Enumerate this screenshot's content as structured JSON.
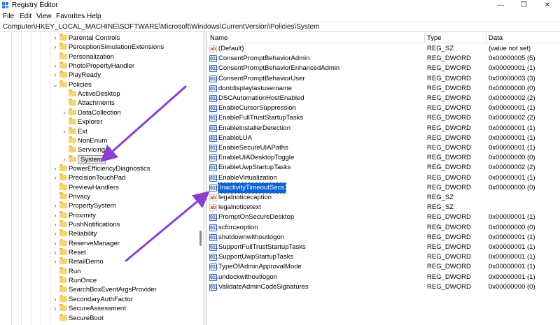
{
  "window": {
    "title": "Registry Editor",
    "minimize_glyph": "—",
    "maximize_glyph": "❐",
    "close_glyph": "✕"
  },
  "menu": [
    "File",
    "Edit",
    "View",
    "Favorites",
    "Help"
  ],
  "address": "Computer\\HKEY_LOCAL_MACHINE\\SOFTWARE\\Microsoft\\Windows\\CurrentVersion\\Policies\\System",
  "tree": [
    {
      "label": "Parental Controls",
      "level": 0,
      "expander": "collapsed"
    },
    {
      "label": "PerceptionSimulationExtensions",
      "level": 0,
      "expander": "collapsed"
    },
    {
      "label": "Personalization",
      "level": 0,
      "expander": "none"
    },
    {
      "label": "PhotoPropertyHandler",
      "level": 0,
      "expander": "collapsed"
    },
    {
      "label": "PlayReady",
      "level": 0,
      "expander": "collapsed"
    },
    {
      "label": "Policies",
      "level": 0,
      "expander": "expanded"
    },
    {
      "label": "ActiveDesktop",
      "level": 1,
      "expander": "none"
    },
    {
      "label": "Attachments",
      "level": 1,
      "expander": "none"
    },
    {
      "label": "DataCollection",
      "level": 1,
      "expander": "collapsed"
    },
    {
      "label": "Explorer",
      "level": 1,
      "expander": "none"
    },
    {
      "label": "Ext",
      "level": 1,
      "expander": "collapsed"
    },
    {
      "label": "NonEnum",
      "level": 1,
      "expander": "none"
    },
    {
      "label": "Servicing",
      "level": 1,
      "expander": "none"
    },
    {
      "label": "System",
      "level": 1,
      "expander": "collapsed",
      "selected": true
    },
    {
      "label": "PowerEfficiencyDiagnostics",
      "level": 0,
      "expander": "collapsed"
    },
    {
      "label": "PrecisionTouchPad",
      "level": 0,
      "expander": "collapsed"
    },
    {
      "label": "PreviewHandlers",
      "level": 0,
      "expander": "none"
    },
    {
      "label": "Privacy",
      "level": 0,
      "expander": "none"
    },
    {
      "label": "PropertySystem",
      "level": 0,
      "expander": "collapsed"
    },
    {
      "label": "Proximity",
      "level": 0,
      "expander": "collapsed"
    },
    {
      "label": "PushNotifications",
      "level": 0,
      "expander": "collapsed"
    },
    {
      "label": "Reliability",
      "level": 0,
      "expander": "collapsed"
    },
    {
      "label": "ReserveManager",
      "level": 0,
      "expander": "collapsed"
    },
    {
      "label": "Reset",
      "level": 0,
      "expander": "collapsed"
    },
    {
      "label": "RetailDemo",
      "level": 0,
      "expander": "collapsed"
    },
    {
      "label": "Run",
      "level": 0,
      "expander": "none"
    },
    {
      "label": "RunOnce",
      "level": 0,
      "expander": "none"
    },
    {
      "label": "SearchBoxEventArgsProvider",
      "level": 0,
      "expander": "none"
    },
    {
      "label": "SecondaryAuthFactor",
      "level": 0,
      "expander": "collapsed"
    },
    {
      "label": "SecureAssessment",
      "level": 0,
      "expander": "collapsed"
    },
    {
      "label": "SecureBoot",
      "level": 0,
      "expander": "none"
    }
  ],
  "list_columns": {
    "name": "Name",
    "type": "Type",
    "data": "Data"
  },
  "values": [
    {
      "name": "(Default)",
      "type": "REG_SZ",
      "data": "(value not set)",
      "icon": "sz"
    },
    {
      "name": "ConsentPromptBehaviorAdmin",
      "type": "REG_DWORD",
      "data": "0x00000005 (5)",
      "icon": "dword"
    },
    {
      "name": "ConsentPromptBehaviorEnhancedAdmin",
      "type": "REG_DWORD",
      "data": "0x00000001 (1)",
      "icon": "dword"
    },
    {
      "name": "ConsentPromptBehaviorUser",
      "type": "REG_DWORD",
      "data": "0x00000003 (3)",
      "icon": "dword"
    },
    {
      "name": "dontdisplaylastusername",
      "type": "REG_DWORD",
      "data": "0x00000000 (0)",
      "icon": "dword"
    },
    {
      "name": "DSCAutomationHostEnabled",
      "type": "REG_DWORD",
      "data": "0x00000002 (2)",
      "icon": "dword"
    },
    {
      "name": "EnableCursorSuppression",
      "type": "REG_DWORD",
      "data": "0x00000001 (1)",
      "icon": "dword"
    },
    {
      "name": "EnableFullTrustStartupTasks",
      "type": "REG_DWORD",
      "data": "0x00000002 (2)",
      "icon": "dword"
    },
    {
      "name": "EnableInstallerDetection",
      "type": "REG_DWORD",
      "data": "0x00000001 (1)",
      "icon": "dword"
    },
    {
      "name": "EnableLUA",
      "type": "REG_DWORD",
      "data": "0x00000001 (1)",
      "icon": "dword"
    },
    {
      "name": "EnableSecureUIAPaths",
      "type": "REG_DWORD",
      "data": "0x00000001 (1)",
      "icon": "dword"
    },
    {
      "name": "EnableUIADesktopToggle",
      "type": "REG_DWORD",
      "data": "0x00000000 (0)",
      "icon": "dword"
    },
    {
      "name": "EnableUwpStartupTasks",
      "type": "REG_DWORD",
      "data": "0x00000002 (2)",
      "icon": "dword"
    },
    {
      "name": "EnableVirtualization",
      "type": "REG_DWORD",
      "data": "0x00000001 (1)",
      "icon": "dword"
    },
    {
      "name": "InactivityTimeoutSecs",
      "type": "REG_DWORD",
      "data": "0x00000000 (0)",
      "icon": "dword",
      "selected": true
    },
    {
      "name": "legalnoticecaption",
      "type": "REG_SZ",
      "data": "",
      "icon": "sz"
    },
    {
      "name": "legalnoticetext",
      "type": "REG_SZ",
      "data": "",
      "icon": "sz"
    },
    {
      "name": "PromptOnSecureDesktop",
      "type": "REG_DWORD",
      "data": "0x00000001 (1)",
      "icon": "dword"
    },
    {
      "name": "scforceoption",
      "type": "REG_DWORD",
      "data": "0x00000000 (0)",
      "icon": "dword"
    },
    {
      "name": "shutdownwithoutlogon",
      "type": "REG_DWORD",
      "data": "0x00000001 (1)",
      "icon": "dword"
    },
    {
      "name": "SupportFullTrustStartupTasks",
      "type": "REG_DWORD",
      "data": "0x00000001 (1)",
      "icon": "dword"
    },
    {
      "name": "SupportUwpStartupTasks",
      "type": "REG_DWORD",
      "data": "0x00000001 (1)",
      "icon": "dword"
    },
    {
      "name": "TypeOfAdminApprovalMode",
      "type": "REG_DWORD",
      "data": "0x00000001 (1)",
      "icon": "dword"
    },
    {
      "name": "undockwithoutlogon",
      "type": "REG_DWORD",
      "data": "0x00000001 (1)",
      "icon": "dword"
    },
    {
      "name": "ValidateAdminCodeSignatures",
      "type": "REG_DWORD",
      "data": "0x00000000 (0)",
      "icon": "dword"
    }
  ],
  "icons": {
    "sz": "ab",
    "dword": "011"
  },
  "colors": {
    "selection": "#0a64d6",
    "annotation_arrow": "#8a3fd1",
    "folder": "#f3d479"
  }
}
